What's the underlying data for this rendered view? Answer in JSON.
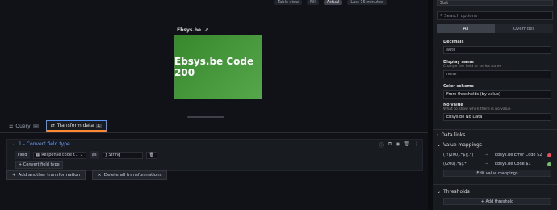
{
  "toolbar": {
    "table_view": "Table view",
    "fill": "Fill",
    "actual": "Actual",
    "time_range": "Last 15 minutes"
  },
  "panel": {
    "title": "Ebsys.be",
    "stat_value": "Ebsys.be Code 200",
    "stat_color": "#56a64b"
  },
  "tabs": [
    {
      "label": "Query",
      "count": "1"
    },
    {
      "label": "Transform data",
      "count": "1"
    }
  ],
  "transform": {
    "title": "1 - Convert field type",
    "field_label": "Field",
    "field_value": "Response code f...",
    "as_label": "as",
    "type_value": "String",
    "add_convert": "Convert field type"
  },
  "actions": {
    "add_transformation": "Add another transformation",
    "delete_all": "Delete all transformations"
  },
  "options": {
    "viz": "Stat",
    "search_placeholder": "Search options",
    "seg_all": "All",
    "seg_overrides": "Overrides",
    "decimals_label": "Decimals",
    "decimals_value": "auto",
    "display_name_label": "Display name",
    "display_name_desc": "Change the field or series name",
    "display_name_value": "none",
    "color_scheme_label": "Color scheme",
    "color_scheme_value": "From thresholds (by value)",
    "no_value_label": "No value",
    "no_value_desc": "What to show when there is no value",
    "no_value_value": "Ebsys.be No Data",
    "data_links": "Data links",
    "value_mappings": "Value mappings",
    "mappings": [
      {
        "from": "(?!(200).*$)(.*)",
        "to": "Ebsys.be Error Code $2",
        "color": "#f2495c"
      },
      {
        "from": "((200).*$).*",
        "to": "Ebsys.be Code $1",
        "color": "#73bf69"
      }
    ],
    "edit_mappings": "Edit value mappings",
    "thresholds": "Thresholds",
    "add_threshold": "+ Add threshold"
  }
}
